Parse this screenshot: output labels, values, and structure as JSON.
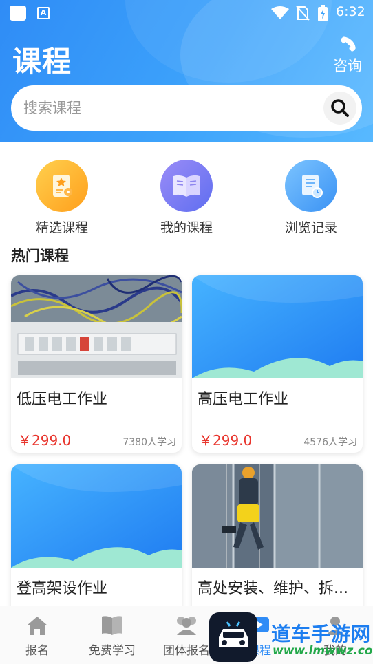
{
  "status_bar": {
    "time": "6:32",
    "a_icon": "A"
  },
  "header": {
    "title": "课程",
    "consult_label": "咨询",
    "search_placeholder": "搜索课程",
    "colors": {
      "gradient_start": "#2f8cf6",
      "gradient_end": "#58b9ff"
    }
  },
  "quick_entries": [
    {
      "label": "精选课程",
      "icon": "featured-course-icon",
      "color": "#ffb52e"
    },
    {
      "label": "我的课程",
      "icon": "open-book-icon",
      "color": "#7c7cf3"
    },
    {
      "label": "浏览记录",
      "icon": "history-doc-icon",
      "color": "#4aa6fb"
    }
  ],
  "hot_section": {
    "title": "热门课程",
    "courses": [
      {
        "title": "低压电工作业",
        "price": "￥299.0",
        "learners": "7380人学习"
      },
      {
        "title": "高压电工作业",
        "price": "￥299.0",
        "learners": "4576人学习"
      },
      {
        "title": "登高架设作业"
      },
      {
        "title": "高处安装、维护、拆..."
      }
    ]
  },
  "bottom_nav": [
    {
      "label": "报名",
      "icon": "home-icon"
    },
    {
      "label": "免费学习",
      "icon": "book-icon"
    },
    {
      "label": "团体报名",
      "icon": "group-icon"
    },
    {
      "label": "课程",
      "icon": "course-play-icon",
      "active": true
    },
    {
      "label": "我的",
      "icon": "user-icon"
    }
  ],
  "watermark": {
    "name": "道车手游网",
    "url": "www.lmwwz.com"
  },
  "accent_price_color": "#e8342c"
}
